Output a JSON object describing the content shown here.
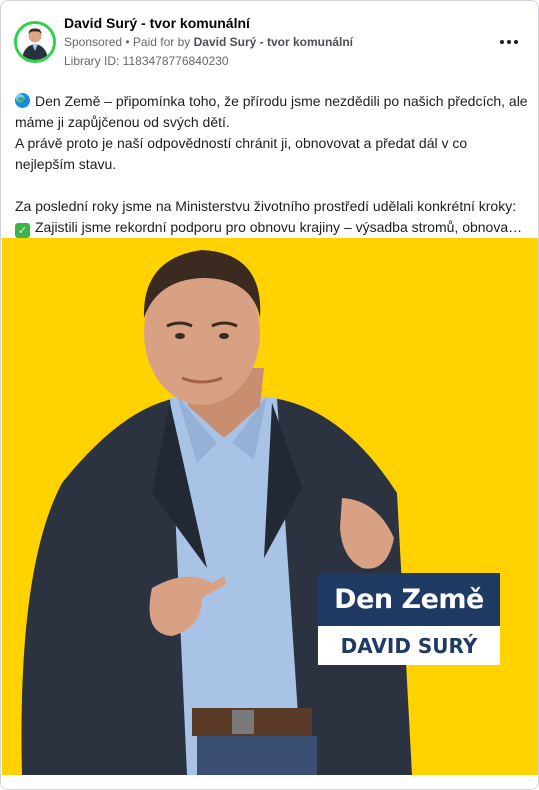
{
  "post": {
    "page_name": "David Surý - tvor komunální",
    "sponsored_label": "Sponsored",
    "paid_for_prefix": "• Paid for by",
    "paid_for_name": "David Surý - tvor komunální",
    "library_id": "Library ID: 1183478776840230",
    "more_icon": "more-horizontal-icon"
  },
  "text": {
    "line1": "Den Země – připomínka toho, že přírodu jsme nezdědili po našich předcích, ale máme ji zapůjčenou od svých dětí.",
    "line2": "A právě proto je naší odpovědností chránit ji, obnovovat a předat dál v co nejlepším stavu.",
    "line3": "Za poslední roky jsme na Ministerstvu životního prostředí udělali konkrétní kroky:",
    "line4": "Zajistili jsme rekordní podporu pro obnovu krajiny – výsadba stromů, obnova…"
  },
  "image": {
    "title": "Den Země",
    "name": "DAVID SURÝ"
  },
  "colors": {
    "background": "#ffd200",
    "badge_navy": "#1f3a63",
    "avatar_ring": "#2fd24b"
  }
}
